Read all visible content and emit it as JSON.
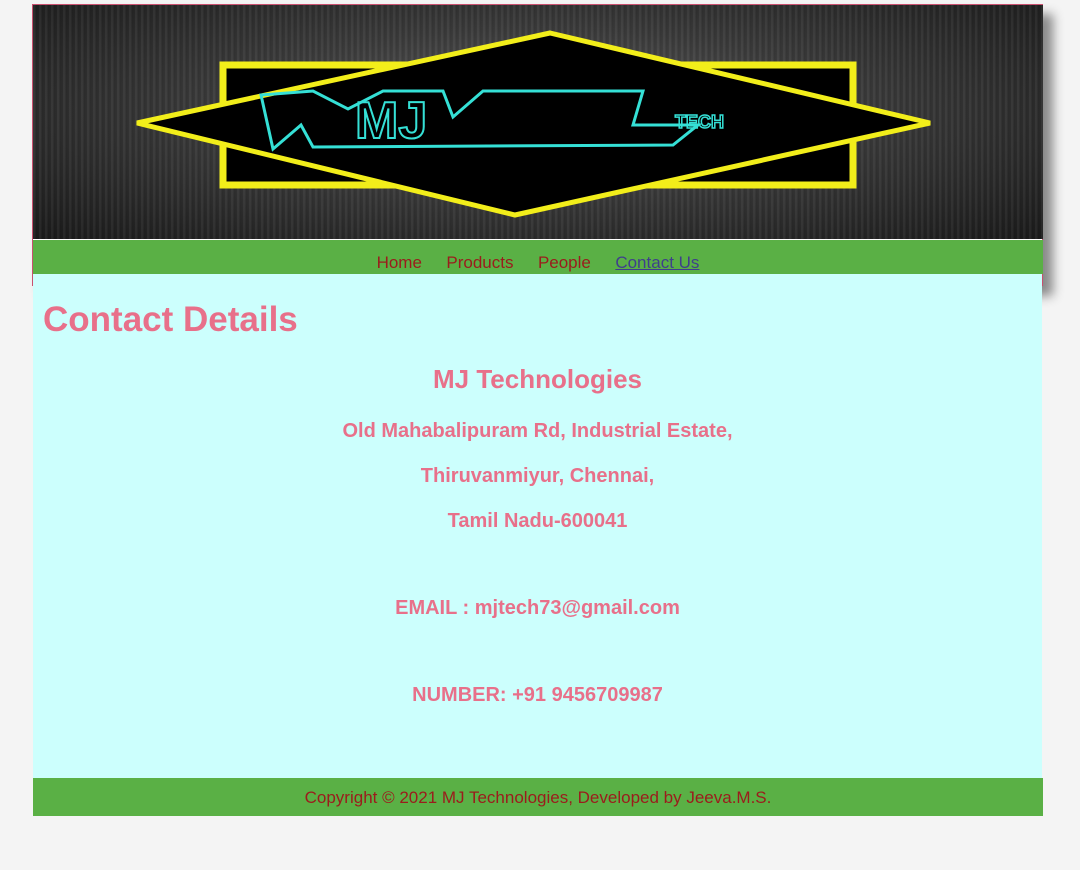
{
  "banner": {
    "logo_main": "MJ",
    "logo_sub": "TECH"
  },
  "nav": {
    "items": [
      {
        "label": "Home"
      },
      {
        "label": "Products"
      },
      {
        "label": "People"
      },
      {
        "label": "Contact Us",
        "active": true
      }
    ]
  },
  "content": {
    "title": "Contact Details",
    "company": "MJ Technologies",
    "address": [
      "Old Mahabalipuram Rd, Industrial Estate,",
      "Thiruvanmiyur, Chennai,",
      "Tamil Nadu-600041"
    ],
    "email": "EMAIL : mjtech73@gmail.com",
    "number": "NUMBER: +91 9456709987"
  },
  "footer": {
    "text": "Copyright © 2021 MJ Technologies, Developed by Jeeva.M.S."
  },
  "colors": {
    "nav_bg": "#5ab045",
    "content_bg": "#ccfffd",
    "text_pink": "#e8708a",
    "link_red": "#9b1c1c",
    "logo_yellow": "#f2ee1a",
    "logo_cyan": "#35e0d6"
  }
}
